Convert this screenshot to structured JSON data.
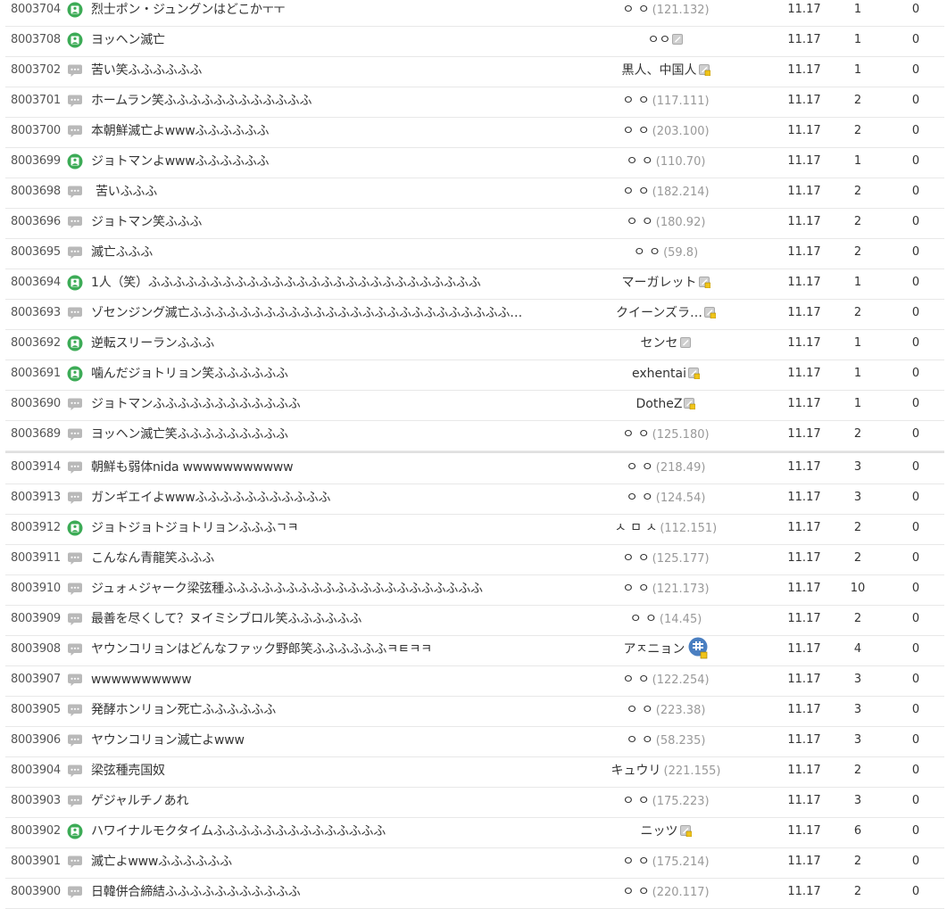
{
  "colors": {
    "image_icon": "#3cab56",
    "comment_icon": "#b9b9b9",
    "ip_text": "#999999",
    "gallercon_badge": "#4a7fc1"
  },
  "icons": {
    "image": "image-post-icon",
    "text": "text-post-icon",
    "nickname": "fixed-nickname-icon",
    "nickname_half": "half-fixed-nickname-icon"
  },
  "rows": [
    {
      "no": "8003704",
      "type": "image",
      "title": "烈士ポン・ジュングンはどこかㅜㅜ",
      "writer": "ㅇ ㅇ",
      "ip": "(121.132)",
      "date": "11.17",
      "views": "1",
      "recommends": "0"
    },
    {
      "no": "8003708",
      "type": "image",
      "title": "ヨッヘン滅亡",
      "writer": "ㅇㅇ",
      "ip": "",
      "badge": "nickname",
      "date": "11.17",
      "views": "1",
      "recommends": "0"
    },
    {
      "no": "8003702",
      "type": "text",
      "title": "苦い笑ふふふふふふ",
      "writer": "黒人、中国人",
      "ip": "",
      "badge": "nickname_half",
      "date": "11.17",
      "views": "1",
      "recommends": "0"
    },
    {
      "no": "8003701",
      "type": "text",
      "title": "ホームラン笑ふふふふふふふふふふふふ",
      "writer": "ㅇ ㅇ",
      "ip": "(117.111)",
      "date": "11.17",
      "views": "2",
      "recommends": "0"
    },
    {
      "no": "8003700",
      "type": "text",
      "title": "本朝鮮滅亡よwwwふふふふふふ",
      "writer": "ㅇ ㅇ",
      "ip": "(203.100)",
      "date": "11.17",
      "views": "2",
      "recommends": "0"
    },
    {
      "no": "8003699",
      "type": "image",
      "title": "ジョトマンよwwwふふふふふふ",
      "writer": "ㅇ ㅇ",
      "ip": "(110.70)",
      "date": "11.17",
      "views": "1",
      "recommends": "0"
    },
    {
      "no": "8003698",
      "type": "text",
      "title": "苦いふふふ",
      "pad": true,
      "writer": "ㅇ ㅇ",
      "ip": "(182.214)",
      "date": "11.17",
      "views": "2",
      "recommends": "0"
    },
    {
      "no": "8003696",
      "type": "text",
      "title": "ジョトマン笑ふふふ",
      "writer": "ㅇ ㅇ",
      "ip": "(180.92)",
      "date": "11.17",
      "views": "2",
      "recommends": "0"
    },
    {
      "no": "8003695",
      "type": "text",
      "title": "滅亡ふふふ",
      "writer": "ㅇ ㅇ",
      "ip": "(59.8)",
      "date": "11.17",
      "views": "2",
      "recommends": "0"
    },
    {
      "no": "8003694",
      "type": "image",
      "title": "1人（笑）ふふふふふふふふふふふふふふふふふふふふふふふふふふふ",
      "writer": "マーガレット",
      "ip": "",
      "badge": "nickname_half",
      "date": "11.17",
      "views": "1",
      "recommends": "0"
    },
    {
      "no": "8003693",
      "type": "text",
      "title": "ゾセンジング滅亡ふふふふふふふふふふふふふふふふふふふふふふふふふふ…",
      "writer": "クイーンズラ…",
      "ip": "",
      "badge": "nickname_half",
      "date": "11.17",
      "views": "2",
      "recommends": "0"
    },
    {
      "no": "8003692",
      "type": "image",
      "title": "逆転スリーランふふふ",
      "writer": "センセ",
      "ip": "",
      "badge": "nickname",
      "date": "11.17",
      "views": "1",
      "recommends": "0"
    },
    {
      "no": "8003691",
      "type": "image",
      "title": "噛んだジョトリョン笑ふふふふふふ",
      "writer": "exhentai",
      "ip": "",
      "badge": "nickname_half",
      "date": "11.17",
      "views": "1",
      "recommends": "0"
    },
    {
      "no": "8003690",
      "type": "text",
      "title": "ジョトマンふふふふふふふふふふふふ",
      "writer": "DotheZ",
      "ip": "",
      "badge": "nickname_half",
      "date": "11.17",
      "views": "1",
      "recommends": "0"
    },
    {
      "no": "8003689",
      "type": "text",
      "title": "ヨッヘン滅亡笑ふふふふふふふふふ",
      "writer": "ㅇ ㅇ",
      "ip": "(125.180)",
      "date": "11.17",
      "views": "2",
      "recommends": "0"
    },
    {
      "no": "8003914",
      "type": "text",
      "title": "朝鮮も弱体nida wwwwwwwwwww",
      "writer": "ㅇ ㅇ",
      "ip": "(218.49)",
      "date": "11.17",
      "views": "3",
      "recommends": "0"
    },
    {
      "no": "8003913",
      "type": "text",
      "title": "ガンギエイよwwwふふふふふふふふふふふ",
      "writer": "ㅇ ㅇ",
      "ip": "(124.54)",
      "date": "11.17",
      "views": "3",
      "recommends": "0"
    },
    {
      "no": "8003912",
      "type": "image",
      "title": "ジョトジョトジョトリョンふふふㄱㅋ",
      "writer": "ㅅ ㅁ ㅅ",
      "ip": "(112.151)",
      "date": "11.17",
      "views": "2",
      "recommends": "0"
    },
    {
      "no": "8003911",
      "type": "text",
      "title": "こんなん青龍笑ふふふ",
      "writer": "ㅇ ㅇ",
      "ip": "(125.177)",
      "date": "11.17",
      "views": "2",
      "recommends": "0"
    },
    {
      "no": "8003910",
      "type": "text",
      "title": "ジュォㅅジャーク梁弦種ふふふふふふふふふふふふふふふふふふふふふ",
      "writer": "ㅇ ㅇ",
      "ip": "(121.173)",
      "date": "11.17",
      "views": "10",
      "recommends": "0"
    },
    {
      "no": "8003909",
      "type": "text",
      "title": "最善を尽くして？ヌイミシブロル笑ふふふふふふ",
      "writer": "ㅇ ㅇ",
      "ip": "(14.45)",
      "date": "11.17",
      "views": "2",
      "recommends": "0"
    },
    {
      "no": "8003908",
      "type": "text",
      "title": "ヤウンコリョンはどんなファック野郎笑ふふふふふふㅋㅌㅋㅋ",
      "writer": "アㅈニョン",
      "ip": "",
      "badge": "gallercon",
      "date": "11.17",
      "views": "4",
      "recommends": "0"
    },
    {
      "no": "8003907",
      "type": "text",
      "title": "wwwwwwwwww",
      "writer": "ㅇ ㅇ",
      "ip": "(122.254)",
      "date": "11.17",
      "views": "3",
      "recommends": "0"
    },
    {
      "no": "8003905",
      "type": "text",
      "title": "発酵ホンリョン死亡ふふふふふふ",
      "writer": "ㅇ ㅇ",
      "ip": "(223.38)",
      "date": "11.17",
      "views": "3",
      "recommends": "0"
    },
    {
      "no": "8003906",
      "type": "text",
      "title": "ヤウンコリョン滅亡よwww",
      "writer": "ㅇ ㅇ",
      "ip": "(58.235)",
      "date": "11.17",
      "views": "3",
      "recommends": "0"
    },
    {
      "no": "8003904",
      "type": "text",
      "title": "梁弦種売国奴",
      "writer": "キュウリ",
      "ip": "(221.155)",
      "date": "11.17",
      "views": "2",
      "recommends": "0"
    },
    {
      "no": "8003903",
      "type": "text",
      "title": "ゲジャルチノあれ",
      "writer": "ㅇ ㅇ",
      "ip": "(175.223)",
      "date": "11.17",
      "views": "3",
      "recommends": "0"
    },
    {
      "no": "8003902",
      "type": "image",
      "title": "ハワイナルモクタイムふふふふふふふふふふふふふふ",
      "writer": "ニッツ",
      "ip": "",
      "badge": "nickname_half",
      "date": "11.17",
      "views": "6",
      "recommends": "0"
    },
    {
      "no": "8003901",
      "type": "text",
      "title": "滅亡よwwwふふふふふふ",
      "writer": "ㅇ ㅇ",
      "ip": "(175.214)",
      "date": "11.17",
      "views": "2",
      "recommends": "0"
    },
    {
      "no": "8003900",
      "type": "text",
      "title": "日韓併合締結ふふふふふふふふふふふ",
      "writer": "ㅇ ㅇ",
      "ip": "(220.117)",
      "date": "11.17",
      "views": "2",
      "recommends": "0"
    }
  ]
}
